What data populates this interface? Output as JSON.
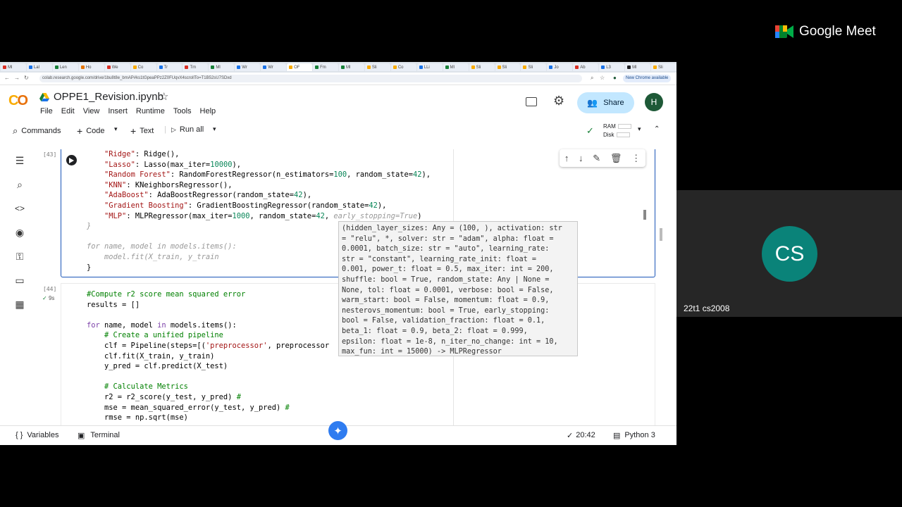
{
  "meet": {
    "logo_text": "Google Meet",
    "participant_initials": "CS",
    "participant_name": "22t1 cs2008"
  },
  "browser": {
    "tabs": [
      {
        "label": "Ml",
        "color": "#d93025"
      },
      {
        "label": "Lal",
        "color": "#1a73e8"
      },
      {
        "label": "Len",
        "color": "#188038"
      },
      {
        "label": "Ho",
        "color": "#e37400"
      },
      {
        "label": "We",
        "color": "#d93025"
      },
      {
        "label": "Co",
        "color": "#f9ab00"
      },
      {
        "label": "Tr",
        "color": "#1a73e8"
      },
      {
        "label": "Tm",
        "color": "#d93025"
      },
      {
        "label": "Ml",
        "color": "#188038"
      },
      {
        "label": "Wr",
        "color": "#1a73e8"
      },
      {
        "label": "Wr",
        "color": "#1a73e8"
      },
      {
        "label": "OF",
        "color": "#f9ab00",
        "active": true
      },
      {
        "label": "Fm",
        "color": "#188038"
      },
      {
        "label": "Ml",
        "color": "#188038"
      },
      {
        "label": "Sli",
        "color": "#f9ab00"
      },
      {
        "label": "Co",
        "color": "#f9ab00"
      },
      {
        "label": "LLi",
        "color": "#1a73e8"
      },
      {
        "label": "Ml",
        "color": "#188038"
      },
      {
        "label": "Sli",
        "color": "#f9ab00"
      },
      {
        "label": "Sli",
        "color": "#f9ab00"
      },
      {
        "label": "Sli",
        "color": "#f9ab00"
      },
      {
        "label": "Jo",
        "color": "#1a73e8"
      },
      {
        "label": "Ab",
        "color": "#d93025"
      },
      {
        "label": "L3",
        "color": "#1a73e8"
      },
      {
        "label": "Ml",
        "color": "#202124"
      },
      {
        "label": "Sli",
        "color": "#f9ab00"
      }
    ],
    "url": "colab.research.google.com/drive/1bu8t8e_bmAP#ks1tGpeaPPz2Z0FUqvX4scrollTo=T1B52sU7SDxd",
    "update_label": "New Chrome available"
  },
  "colab": {
    "notebook_title": "OPPE1_Revision.ipynb",
    "menu": [
      "File",
      "Edit",
      "View",
      "Insert",
      "Runtime",
      "Tools",
      "Help"
    ],
    "share_label": "Share",
    "account_initial": "H",
    "toolbar": {
      "commands": "Commands",
      "code": "Code",
      "text": "Text",
      "run_all": "Run all",
      "ram": "RAM",
      "disk": "Disk"
    }
  },
  "cell1": {
    "exec_count": "[43]",
    "lines": [
      [
        {
          "t": "    "
        },
        {
          "t": "\"Ridge\"",
          "c": "s"
        },
        {
          "t": ": Ridge(),"
        }
      ],
      [
        {
          "t": "    "
        },
        {
          "t": "\"Lasso\"",
          "c": "s"
        },
        {
          "t": ": Lasso(max_iter="
        },
        {
          "t": "10000",
          "c": "n"
        },
        {
          "t": "),"
        }
      ],
      [
        {
          "t": "    "
        },
        {
          "t": "\"Random Forest\"",
          "c": "s"
        },
        {
          "t": ": RandomForestRegressor(n_estimators="
        },
        {
          "t": "100",
          "c": "n"
        },
        {
          "t": ", random_state="
        },
        {
          "t": "42",
          "c": "n"
        },
        {
          "t": "),"
        }
      ],
      [
        {
          "t": "    "
        },
        {
          "t": "\"KNN\"",
          "c": "s"
        },
        {
          "t": ": KNeighborsRegressor(),"
        }
      ],
      [
        {
          "t": "    "
        },
        {
          "t": "\"AdaBoost\"",
          "c": "s"
        },
        {
          "t": ": AdaBoostRegressor(random_state="
        },
        {
          "t": "42",
          "c": "n"
        },
        {
          "t": "),"
        }
      ],
      [
        {
          "t": "    "
        },
        {
          "t": "\"Gradient Boosting\"",
          "c": "s"
        },
        {
          "t": ": GradientBoostingRegressor(random_state="
        },
        {
          "t": "42",
          "c": "n"
        },
        {
          "t": "),"
        }
      ],
      [
        {
          "t": "    "
        },
        {
          "t": "\"MLP\"",
          "c": "s"
        },
        {
          "t": ": MLPRegressor(max_iter="
        },
        {
          "t": "1000",
          "c": "n"
        },
        {
          "t": ", random_state="
        },
        {
          "t": "42",
          "c": "n"
        },
        {
          "t": ", "
        },
        {
          "t": "early_stopping=True",
          "c": "g"
        },
        {
          "t": ")"
        }
      ],
      [
        {
          "t": "}",
          "c": "g"
        }
      ],
      [
        {
          "t": ""
        }
      ],
      [
        {
          "t": "for name, model in models.items():",
          "c": "g"
        }
      ],
      [
        {
          "t": "    model.fit(X_train, y_train",
          "c": "g"
        }
      ],
      [
        {
          "t": "}"
        }
      ]
    ]
  },
  "cell2": {
    "exec_count": "[44]",
    "duration": "9s",
    "lines": [
      [
        {
          "t": "#Compute r2 score mean squared error",
          "c": "c"
        }
      ],
      [
        {
          "t": "results = []"
        }
      ],
      [
        {
          "t": ""
        }
      ],
      [
        {
          "t": "for",
          "c": "k"
        },
        {
          "t": " name, model "
        },
        {
          "t": "in",
          "c": "k"
        },
        {
          "t": " models.items():"
        }
      ],
      [
        {
          "t": "    "
        },
        {
          "t": "# Create a unified pipeline",
          "c": "c"
        }
      ],
      [
        {
          "t": "    clf = Pipeline(steps=[("
        },
        {
          "t": "'preprocessor'",
          "c": "s"
        },
        {
          "t": ", preprocessor"
        }
      ],
      [
        {
          "t": "    clf.fit(X_train, y_train)"
        }
      ],
      [
        {
          "t": "    y_pred = clf.predict(X_test)"
        }
      ],
      [
        {
          "t": ""
        }
      ],
      [
        {
          "t": "    "
        },
        {
          "t": "# Calculate Metrics",
          "c": "c"
        }
      ],
      [
        {
          "t": "    r2 = r2_score(y_test, y_pred) "
        },
        {
          "t": "#",
          "c": "c"
        }
      ],
      [
        {
          "t": "    mse = mean_squared_error(y_test, y_pred) "
        },
        {
          "t": "#",
          "c": "c"
        }
      ],
      [
        {
          "t": "    rmse = np.sqrt(mse)"
        }
      ]
    ]
  },
  "tooltip": {
    "lines": [
      "(hidden_layer_sizes: Any = (100, ), activation: str",
      "= \"relu\", *, solver: str = \"adam\", alpha: float =",
      "0.0001, batch_size: str = \"auto\", learning_rate:",
      "str = \"constant\", learning_rate_init: float =",
      "0.001, power_t: float = 0.5, max_iter: int = 200,",
      "shuffle: bool = True, random_state: Any | None =",
      "None, tol: float = 0.0001, verbose: bool = False,",
      "warm_start: bool = False, momentum: float = 0.9,",
      "nesterovs_momentum: bool = True, early_stopping:",
      "bool = False, validation_fraction: float = 0.1,",
      "beta_1: float = 0.9, beta_2: float = 0.999,",
      "epsilon: float = 1e-8, n_iter_no_change: int = 10,",
      "max_fun: int = 15000) -> MLPRegressor"
    ]
  },
  "statusbar": {
    "variables": "Variables",
    "terminal": "Terminal",
    "time": "20:42",
    "kernel": "Python 3"
  }
}
